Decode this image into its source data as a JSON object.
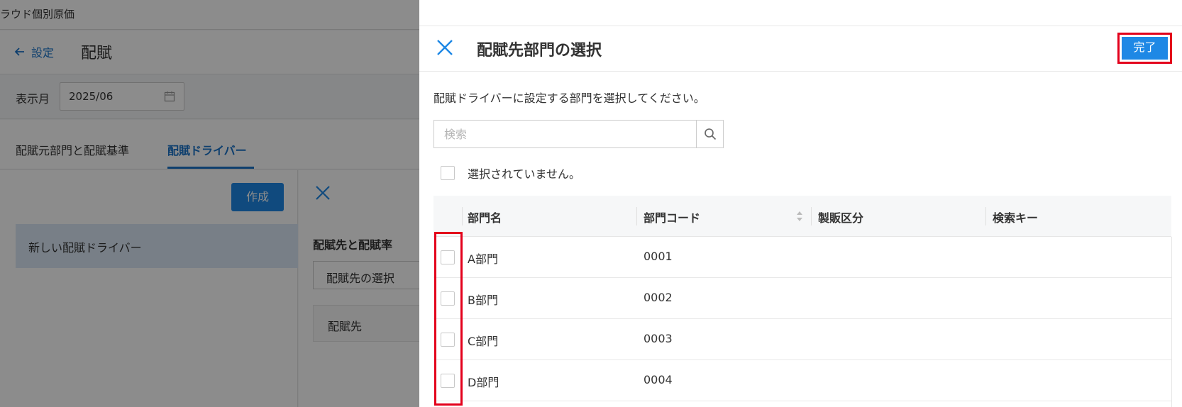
{
  "background": {
    "app_name": "ラウド個別原価",
    "back_label": "設定",
    "page_title": "配賦",
    "month_label": "表示月",
    "month_value": "2025/06",
    "tabs": [
      "配賦元部門と配賦基準",
      "配賦ドライバー"
    ],
    "active_tab": 1,
    "create_label": "作成",
    "driver_item": "新しい配賦ドライバー",
    "alloc_title": "配賦先と配賦率",
    "alloc_select": "配賦先の選択",
    "alloc_col": "配賦先"
  },
  "drawer": {
    "title": "配賦先部門の選択",
    "done_label": "完了",
    "description": "配賦ドライバーに設定する部門を選択してください。",
    "search_placeholder": "検索",
    "select_status": "選択されていません。",
    "columns": [
      "部門名",
      "部門コード",
      "製販区分",
      "検索キー"
    ],
    "rows": [
      {
        "name": "A部門",
        "code": "0001",
        "type": "",
        "key": ""
      },
      {
        "name": "B部門",
        "code": "0002",
        "type": "",
        "key": ""
      },
      {
        "name": "C部門",
        "code": "0003",
        "type": "",
        "key": ""
      },
      {
        "name": "D部門",
        "code": "0004",
        "type": "",
        "key": ""
      }
    ]
  },
  "colors": {
    "primary": "#1e88e5",
    "link": "#1a73c8",
    "highlight": "#e3001b"
  }
}
